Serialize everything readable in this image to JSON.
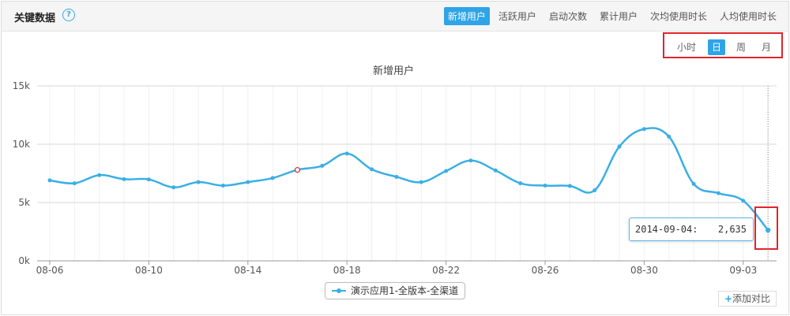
{
  "header": {
    "title": "关键数据",
    "help_icon": "?",
    "tabs": [
      "新增用户",
      "活跃用户",
      "启动次数",
      "累计用户",
      "次均使用时长",
      "人均使用时长"
    ],
    "active_tab": 0
  },
  "period": {
    "options": [
      "小时",
      "日",
      "周",
      "月"
    ],
    "active": 1
  },
  "accent_color": "#2fa4e7",
  "highlight_color": "#e0252a",
  "tooltip": {
    "date": "2014-09-04:",
    "value": "2,635"
  },
  "add_compare": {
    "icon": "+",
    "label": "添加对比"
  },
  "chart_data": {
    "type": "line",
    "title": "新增用户",
    "xlabel": "",
    "ylabel": "",
    "ylim": [
      0,
      15000
    ],
    "yticks": [
      0,
      5000,
      10000,
      15000
    ],
    "ytick_labels": [
      "0k",
      "5k",
      "10k",
      "15k"
    ],
    "xtick_labels": [
      "08-06",
      "08-10",
      "08-14",
      "08-18",
      "08-22",
      "08-26",
      "08-30",
      "09-03"
    ],
    "x": [
      "08-06",
      "08-07",
      "08-08",
      "08-09",
      "08-10",
      "08-11",
      "08-12",
      "08-13",
      "08-14",
      "08-15",
      "08-16",
      "08-17",
      "08-18",
      "08-19",
      "08-20",
      "08-21",
      "08-22",
      "08-23",
      "08-24",
      "08-25",
      "08-26",
      "08-27",
      "08-28",
      "08-29",
      "08-30",
      "08-31",
      "09-01",
      "09-02",
      "09-03",
      "09-04"
    ],
    "series": [
      {
        "name": "演示应用1-全版本-全渠道",
        "color": "#3aaee6",
        "values": [
          6900,
          6650,
          7350,
          7000,
          6980,
          6300,
          6750,
          6450,
          6750,
          7100,
          7800,
          8150,
          9200,
          7850,
          7200,
          6750,
          7700,
          8600,
          7750,
          6650,
          6450,
          6420,
          6050,
          9800,
          11300,
          10650,
          6600,
          5800,
          5150,
          2635
        ]
      }
    ],
    "highlight_point_index": 10,
    "grid": true,
    "legend_position": "bottom-center"
  }
}
